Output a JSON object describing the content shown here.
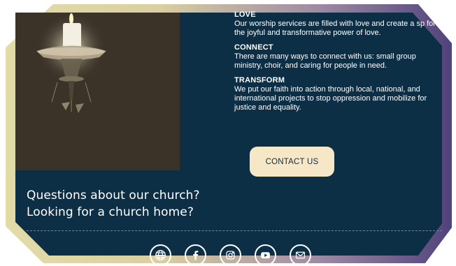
{
  "sections": [
    {
      "heading": "LOVE",
      "body": "Our worship services are filled with love and create a sp for the joyful and transformative power of love."
    },
    {
      "heading": "CONNECT",
      "body": "There are many ways to connect with us: small group ministry, choir, and caring for people in need."
    },
    {
      "heading": "TRANSFORM",
      "body": "We put our faith into action through local, national, and international projects to stop oppression and mobilize for justice and equality."
    }
  ],
  "contact_button": {
    "label": "CONTACT US"
  },
  "questions": {
    "line1": "Questions about our church?",
    "line2": "Looking for a church home?"
  },
  "social_icons": [
    "globe-icon",
    "facebook-icon",
    "instagram-icon",
    "youtube-icon",
    "email-icon"
  ],
  "colors": {
    "panel": "#0d2f45",
    "button": "#f6e8c6",
    "frame_left": "#e3dca8",
    "frame_right": "#4e4079"
  }
}
